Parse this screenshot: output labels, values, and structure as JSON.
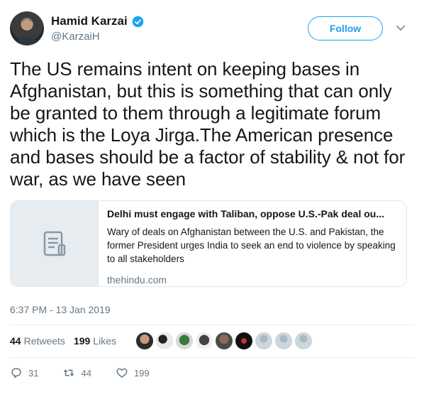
{
  "user": {
    "display_name": "Hamid Karzai",
    "handle": "@KarzaiH",
    "verified": true
  },
  "follow_label": "Follow",
  "tweet_text": "The US remains intent on keeping bases in Afghanistan, but this is something that can only be granted to them through a legitimate forum which is the Loya Jirga.The American presence and bases should be a factor of stability & not for war, as we have seen",
  "card": {
    "title": "Delhi must engage with Taliban, oppose U.S.-Pak deal ou...",
    "description": "Wary of deals on Afghanistan between the U.S. and Pakistan, the former President urges India to seek an end to violence by speaking to all stakeholders",
    "domain": "thehindu.com"
  },
  "timestamp": "6:37 PM - 13 Jan 2019",
  "stats": {
    "retweets_count": "44",
    "retweets_label": "Retweets",
    "likes_count": "199",
    "likes_label": "Likes"
  },
  "actions": {
    "replies": "31",
    "retweets": "44",
    "likes": "199"
  },
  "colors": {
    "accent": "#1da1f2",
    "secondary_text": "#657786",
    "border": "#e1e8ed"
  },
  "icons": [
    "verified-badge-icon",
    "chevron-down-icon",
    "article-icon",
    "reply-icon",
    "retweet-icon",
    "heart-icon"
  ]
}
